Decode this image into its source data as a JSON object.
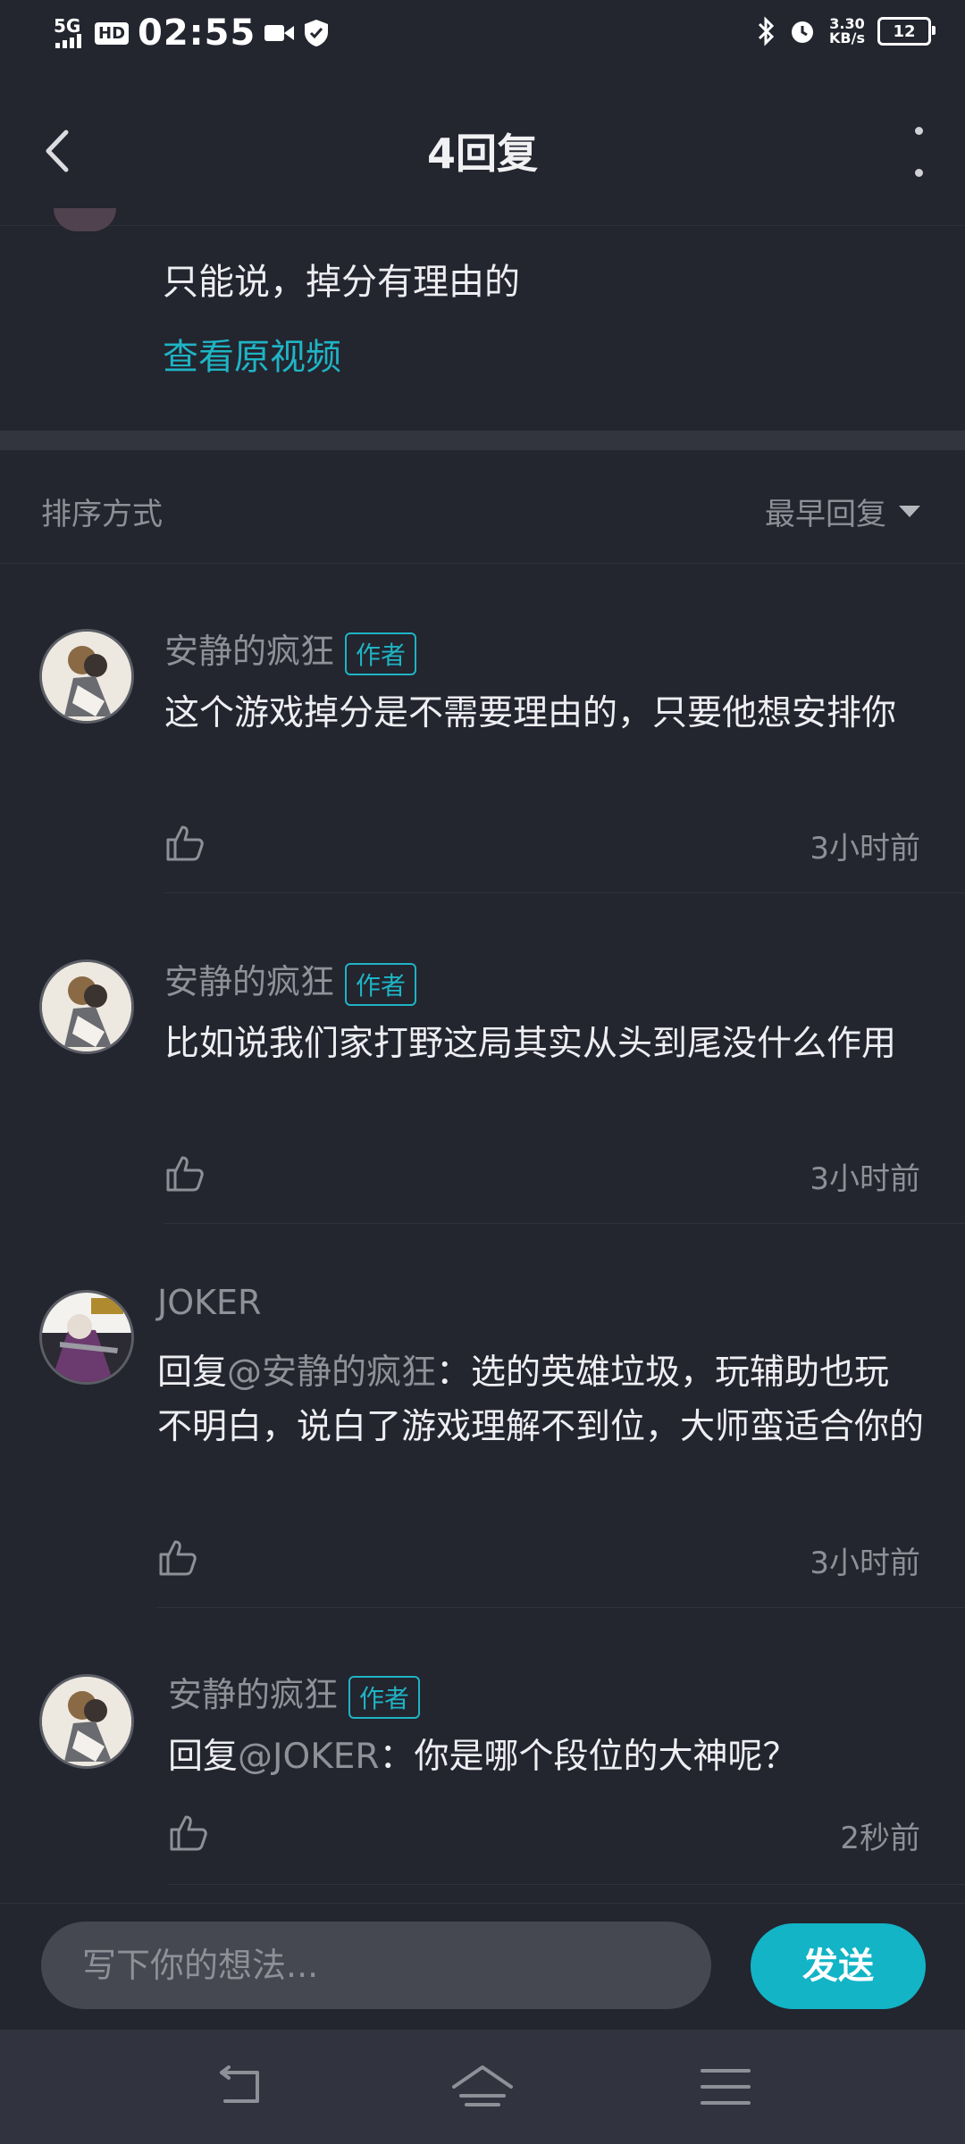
{
  "status_bar": {
    "network": "5G",
    "hd": "HD",
    "time": "02:55",
    "speed_value": "3.30",
    "speed_unit": "KB/s",
    "battery": "12"
  },
  "header": {
    "title": "4回复"
  },
  "original_comment": {
    "text": "只能说，掉分有理由的",
    "view_video": "查看原视频"
  },
  "sort": {
    "label": "排序方式",
    "value": "最早回复"
  },
  "replies": [
    {
      "author": "安静的疯狂",
      "badge": "作者",
      "text": "这个游戏掉分是不需要理由的，只要他想安排你",
      "time": "3小时前"
    },
    {
      "author": "安静的疯狂",
      "badge": "作者",
      "text": "比如说我们家打野这局其实从头到尾没什么作用",
      "time": "3小时前"
    },
    {
      "author": "JOKER",
      "prefix": "回复",
      "mention": "@安静的疯狂",
      "text": "：选的英雄垃圾，玩辅助也玩不明白，说白了游戏理解不到位，大师蛮适合你的",
      "time": "3小时前"
    },
    {
      "author": "安静的疯狂",
      "badge": "作者",
      "prefix": "回复",
      "mention": "@JOKER",
      "text": "：你是哪个段位的大神呢？",
      "time": "2秒前"
    }
  ],
  "composer": {
    "placeholder": "写下你的想法...",
    "send_label": "发送"
  },
  "colors": {
    "background": "#23252f",
    "accent": "#12b4c6",
    "badge": "#1fb4c4"
  }
}
